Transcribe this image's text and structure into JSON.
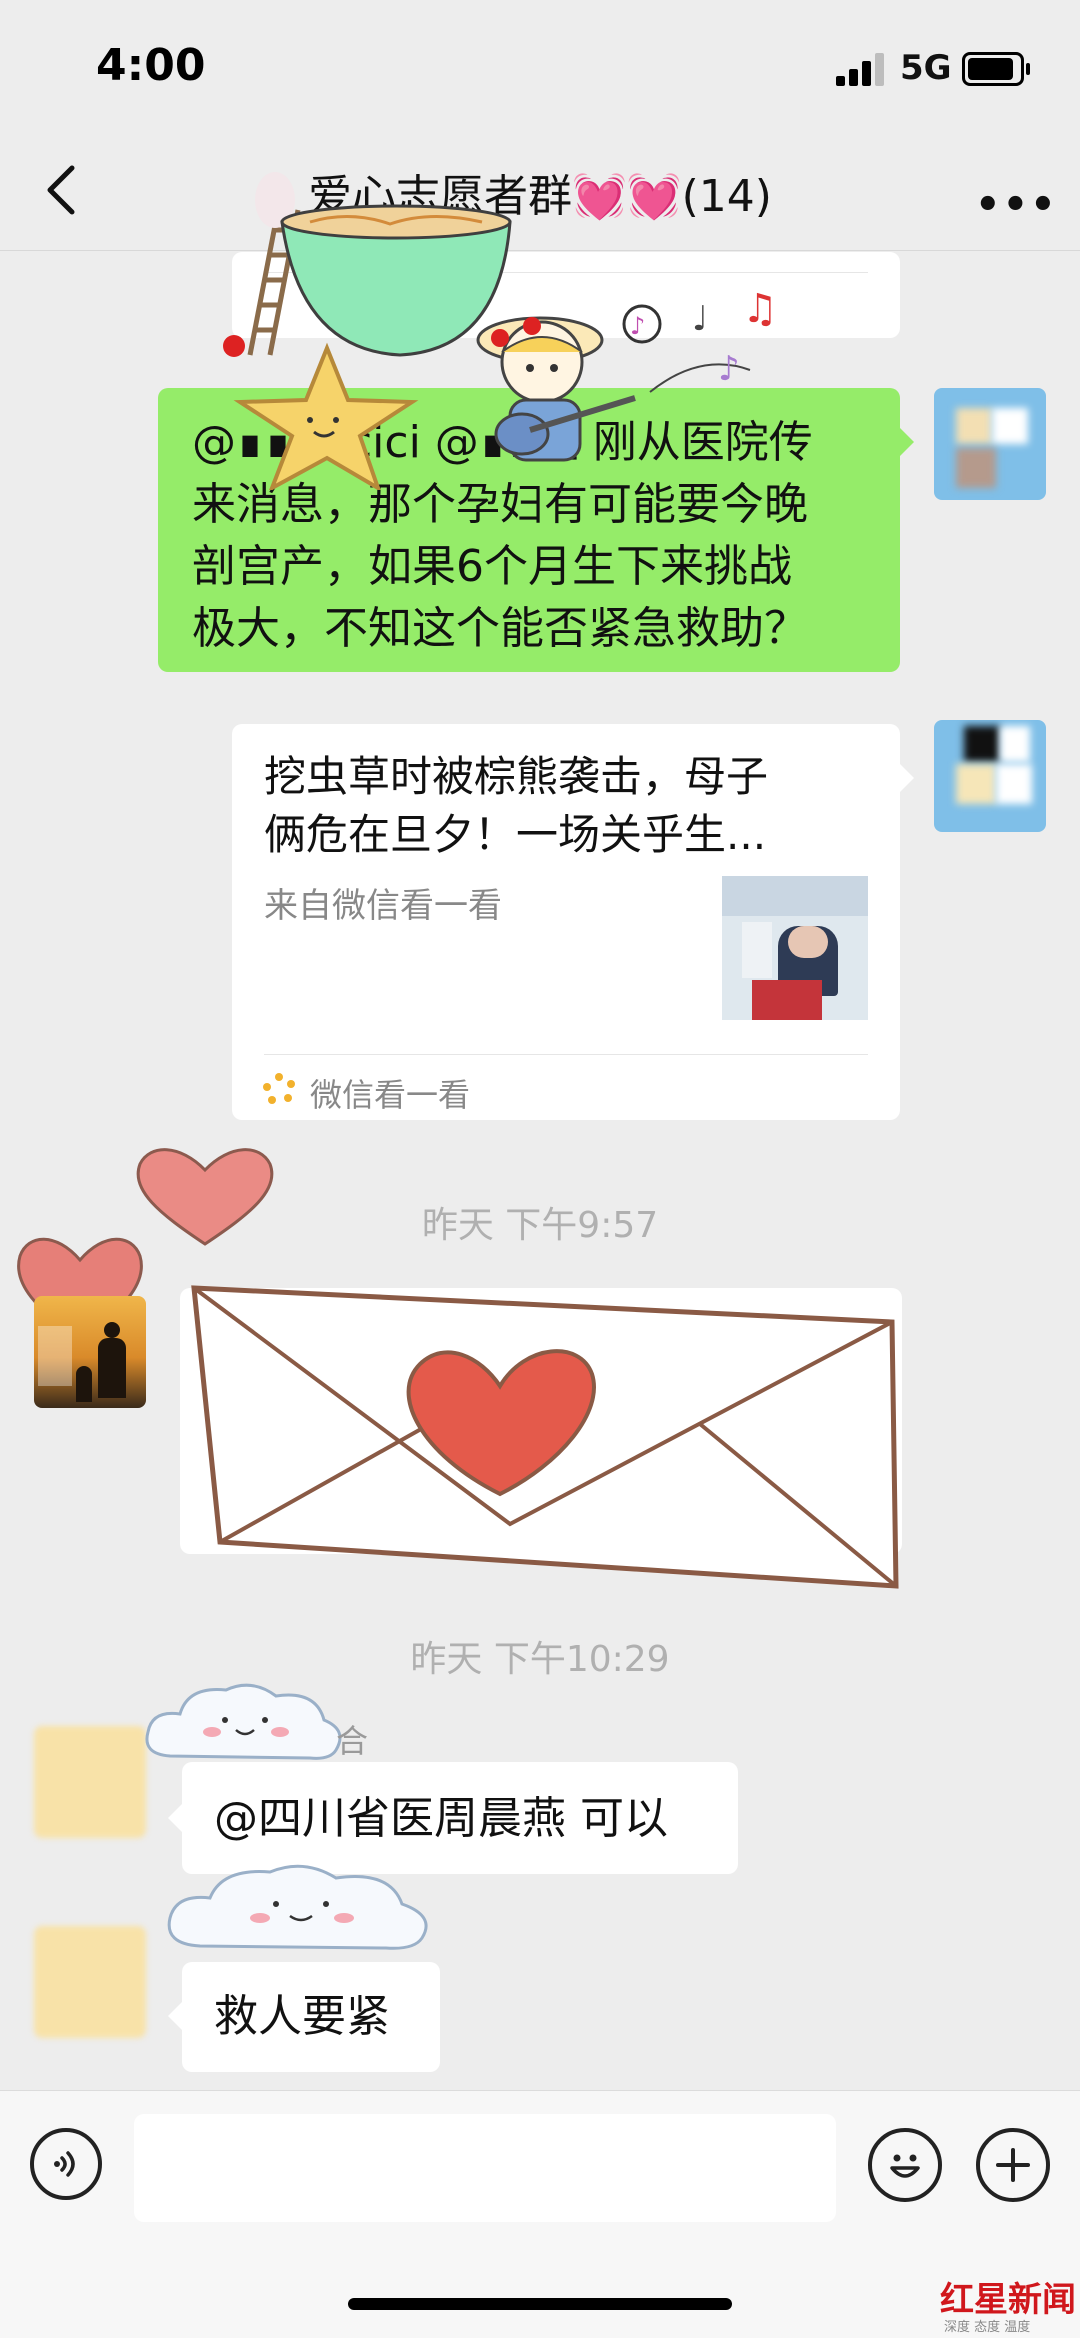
{
  "status_bar": {
    "time": "4:00",
    "network": "5G",
    "signal_bars": 4,
    "battery_level": 0.85
  },
  "nav": {
    "title": "爱心志愿者群💓💓(14)",
    "back_icon": "chevron-left-icon",
    "more_icon": "ellipsis-icon"
  },
  "messages": {
    "green": {
      "lines": [
        "@∎∎∎∎cici @∎∎轻 刚从医院传",
        "来消息，那个孕妇有可能要今晚",
        "剖宫产，如果6个月生下来挑战",
        "极大，不知这个能否紧急救助？"
      ]
    },
    "card": {
      "title_line1": "挖虫草时被棕熊袭击，母子",
      "title_line2": "俩危在旦夕！一场关乎生...",
      "source": "来自微信看一看",
      "footer": "微信看一看"
    },
    "ts1": "昨天 下午9:57",
    "ts2": "昨天 下午10:29",
    "reply1": {
      "sender_suffix": "合",
      "text": "@四川省医周晨燕 可以"
    },
    "reply2": {
      "text": "救人要紧"
    }
  },
  "input_bar": {
    "voice_icon": "voice-icon",
    "emoji_icon": "emoji-icon",
    "plus_icon": "plus-icon"
  },
  "watermark": {
    "text": "红星新闻",
    "sub": "深度 态度 温度"
  },
  "colors": {
    "bubble_green": "#95ec69",
    "background": "#ededed",
    "heart": "#e05a4a"
  }
}
